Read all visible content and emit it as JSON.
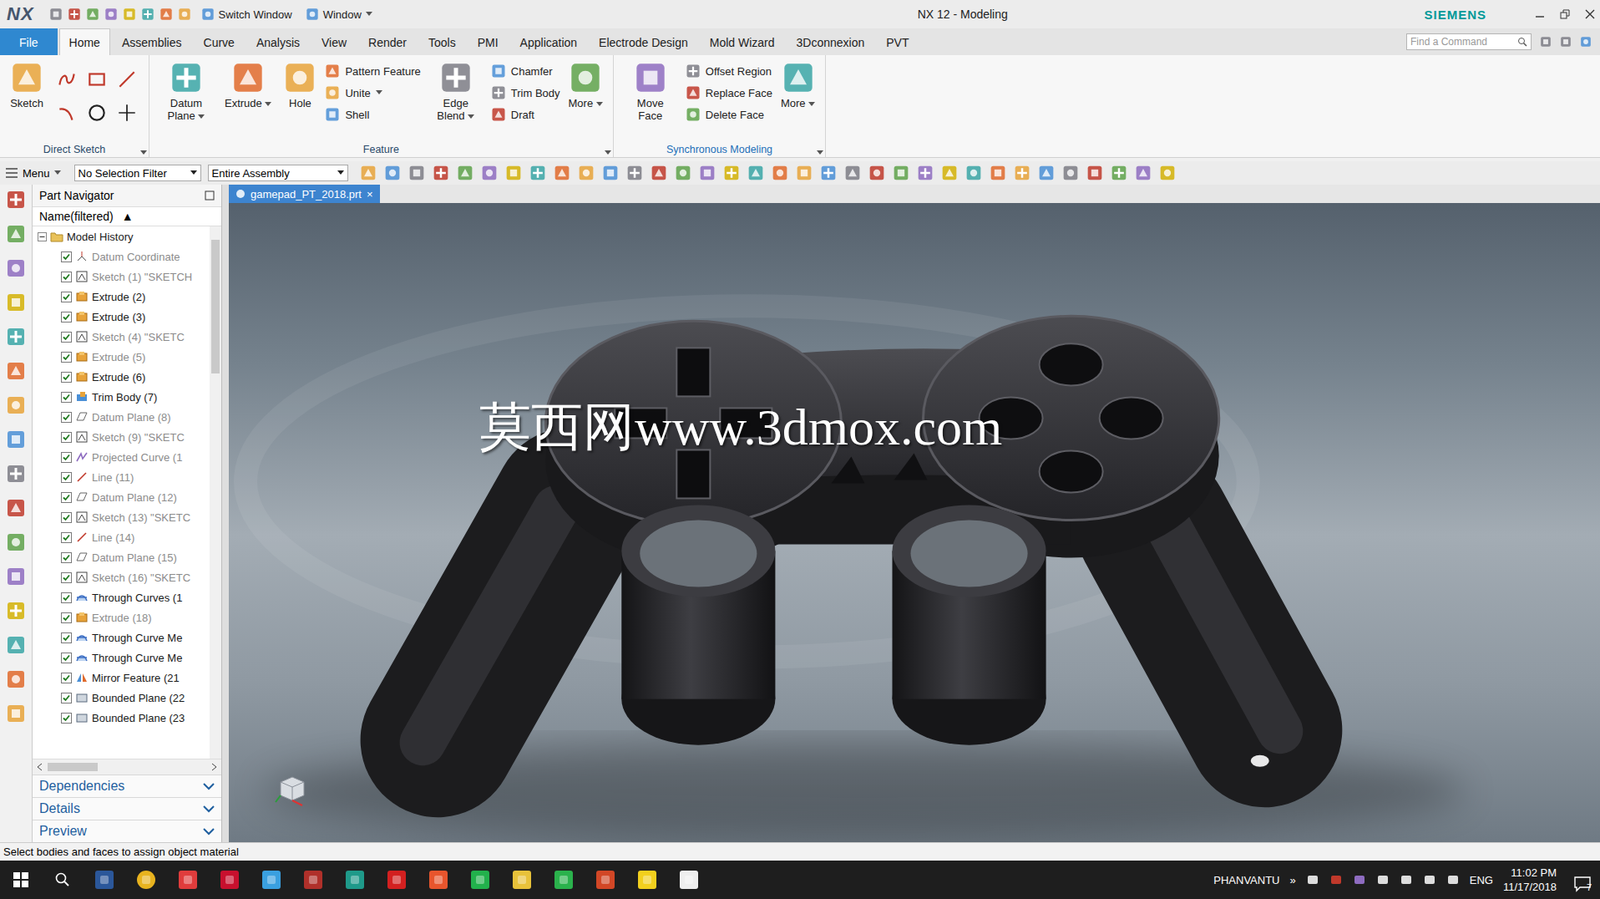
{
  "window": {
    "app_logo": "NX",
    "title": "NX 12 - Modeling",
    "brand": "SIEMENS"
  },
  "quick_access": {
    "switch_window": "Switch Window",
    "window_menu": "Window"
  },
  "ribbon_tabs": [
    {
      "label": "File",
      "selected": false,
      "kind": "file"
    },
    {
      "label": "Home",
      "selected": true,
      "kind": "tab"
    },
    {
      "label": "Assemblies",
      "selected": false,
      "kind": "tab"
    },
    {
      "label": "Curve",
      "selected": false,
      "kind": "tab"
    },
    {
      "label": "Analysis",
      "selected": false,
      "kind": "tab"
    },
    {
      "label": "View",
      "selected": false,
      "kind": "tab"
    },
    {
      "label": "Render",
      "selected": false,
      "kind": "tab"
    },
    {
      "label": "Tools",
      "selected": false,
      "kind": "tab"
    },
    {
      "label": "PMI",
      "selected": false,
      "kind": "tab"
    },
    {
      "label": "Application",
      "selected": false,
      "kind": "tab"
    },
    {
      "label": "Electrode Design",
      "selected": false,
      "kind": "tab"
    },
    {
      "label": "Mold Wizard",
      "selected": false,
      "kind": "tab"
    },
    {
      "label": "3Dconnexion",
      "selected": false,
      "kind": "tab"
    },
    {
      "label": "PVT",
      "selected": false,
      "kind": "tab"
    }
  ],
  "command_search": {
    "placeholder": "Find a Command"
  },
  "ribbon_groups": [
    {
      "title": "Direct Sketch",
      "highlighted": false,
      "controls": [
        {
          "kind": "large",
          "label": "Sketch",
          "dropdown": false
        },
        {
          "kind": "grid"
        }
      ]
    },
    {
      "title": "Feature",
      "highlighted": false,
      "controls": [
        {
          "kind": "large",
          "label": "Datum Plane",
          "dropdown": true
        },
        {
          "kind": "large",
          "label": "Extrude",
          "dropdown": true
        },
        {
          "kind": "large",
          "label": "Hole",
          "dropdown": false
        },
        {
          "kind": "column",
          "items": [
            {
              "label": "Pattern Feature",
              "dropdown": false
            },
            {
              "label": "Unite",
              "dropdown": true
            },
            {
              "label": "Shell",
              "dropdown": false
            }
          ]
        },
        {
          "kind": "large",
          "label": "Edge Blend",
          "dropdown": true
        },
        {
          "kind": "column",
          "items": [
            {
              "label": "Chamfer",
              "dropdown": false
            },
            {
              "label": "Trim Body",
              "dropdown": false
            },
            {
              "label": "Draft",
              "dropdown": false
            }
          ]
        },
        {
          "kind": "large",
          "label": "More",
          "dropdown": true
        }
      ]
    },
    {
      "title": "Synchronous Modeling",
      "highlighted": true,
      "controls": [
        {
          "kind": "large",
          "label": "Move Face",
          "dropdown": false
        },
        {
          "kind": "column",
          "items": [
            {
              "label": "Offset Region",
              "dropdown": false
            },
            {
              "label": "Replace Face",
              "dropdown": false
            },
            {
              "label": "Delete Face",
              "dropdown": false
            }
          ]
        },
        {
          "kind": "large",
          "label": "More",
          "dropdown": true
        }
      ]
    }
  ],
  "selection_bar": {
    "menu": "Menu",
    "filter": "No Selection Filter",
    "scope": "Entire Assembly"
  },
  "navigator": {
    "title": "Part Navigator",
    "column": "Name(filtered)",
    "sort_glyph": "▲",
    "root": {
      "label": "Model History",
      "expanded": true
    },
    "rows": [
      {
        "label": "Datum Coordinate",
        "kind": "datum",
        "checked": true,
        "disabled": true
      },
      {
        "label": "Sketch (1) \"SKETCH",
        "kind": "sketch",
        "checked": true,
        "disabled": true
      },
      {
        "label": "Extrude (2)",
        "kind": "extrude",
        "checked": true,
        "disabled": false
      },
      {
        "label": "Extrude (3)",
        "kind": "extrude",
        "checked": true,
        "disabled": false
      },
      {
        "label": "Sketch (4) \"SKETC",
        "kind": "sketch",
        "checked": true,
        "disabled": true
      },
      {
        "label": "Extrude (5)",
        "kind": "extrude",
        "checked": true,
        "disabled": true
      },
      {
        "label": "Extrude (6)",
        "kind": "extrude",
        "checked": true,
        "disabled": false
      },
      {
        "label": "Trim Body (7)",
        "kind": "trim",
        "checked": true,
        "disabled": false
      },
      {
        "label": "Datum Plane (8)",
        "kind": "plane",
        "checked": true,
        "disabled": true
      },
      {
        "label": "Sketch (9) \"SKETC",
        "kind": "sketch",
        "checked": true,
        "disabled": true
      },
      {
        "label": "Projected Curve (1",
        "kind": "curve",
        "checked": true,
        "disabled": true
      },
      {
        "label": "Line (11)",
        "kind": "line",
        "checked": true,
        "disabled": true
      },
      {
        "label": "Datum Plane (12)",
        "kind": "plane",
        "checked": true,
        "disabled": true
      },
      {
        "label": "Sketch (13) \"SKETC",
        "kind": "sketch",
        "checked": true,
        "disabled": true
      },
      {
        "label": "Line (14)",
        "kind": "line",
        "checked": true,
        "disabled": true
      },
      {
        "label": "Datum Plane (15)",
        "kind": "plane",
        "checked": true,
        "disabled": true
      },
      {
        "label": "Sketch (16) \"SKETC",
        "kind": "sketch",
        "checked": true,
        "disabled": true
      },
      {
        "label": "Through Curves (1",
        "kind": "through",
        "checked": true,
        "disabled": false
      },
      {
        "label": "Extrude (18)",
        "kind": "extrude",
        "checked": true,
        "disabled": true
      },
      {
        "label": "Through Curve Me",
        "kind": "through",
        "checked": true,
        "disabled": false
      },
      {
        "label": "Through Curve Me",
        "kind": "through",
        "checked": true,
        "disabled": false
      },
      {
        "label": "Mirror Feature (21",
        "kind": "mirror",
        "checked": true,
        "disabled": false
      },
      {
        "label": "Bounded Plane (22",
        "kind": "bounded",
        "checked": true,
        "disabled": false
      },
      {
        "label": "Bounded Plane (23",
        "kind": "bounded",
        "checked": true,
        "disabled": false
      }
    ],
    "sections": [
      {
        "label": "Dependencies",
        "expanded": false
      },
      {
        "label": "Details",
        "expanded": false
      },
      {
        "label": "Preview",
        "expanded": false
      }
    ]
  },
  "document_tab": {
    "label": "gamepad_PT_2018.prt",
    "close": "×",
    "selected": true
  },
  "watermark": "莫西网www.3dmox.com",
  "status_bar": "Select bodies and faces to assign object material",
  "taskbar": {
    "user": "PHANVANTU",
    "overflow": "»",
    "language": "ENG",
    "time": "11:02 PM",
    "date": "11/17/2018",
    "notifications": "7"
  }
}
